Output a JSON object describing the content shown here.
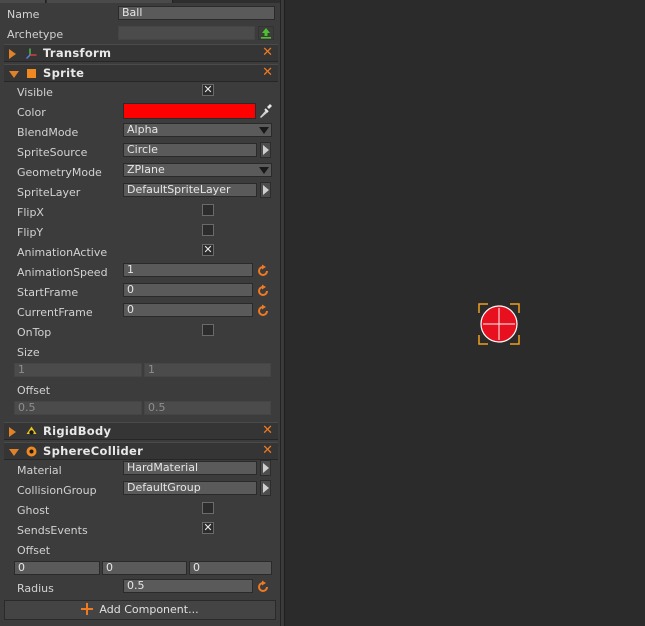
{
  "inspector": {
    "name_label": "Name",
    "name_value": "Ball",
    "archetype_label": "Archetype",
    "archetype_value": "",
    "components": {
      "transform": {
        "title": "Transform"
      },
      "sprite": {
        "title": "Sprite",
        "visible_label": "Visible",
        "visible_checked": true,
        "color_label": "Color",
        "color_value": "#ff0000",
        "blendmode_label": "BlendMode",
        "blendmode_value": "Alpha",
        "spritesource_label": "SpriteSource",
        "spritesource_value": "Circle",
        "geometrymode_label": "GeometryMode",
        "geometrymode_value": "ZPlane",
        "spritelayer_label": "SpriteLayer",
        "spritelayer_value": "DefaultSpriteLayer",
        "flipx_label": "FlipX",
        "flipx_checked": false,
        "flipy_label": "FlipY",
        "flipy_checked": false,
        "animationactive_label": "AnimationActive",
        "animationactive_checked": true,
        "animationspeed_label": "AnimationSpeed",
        "animationspeed_value": "1",
        "startframe_label": "StartFrame",
        "startframe_value": "0",
        "currentframe_label": "CurrentFrame",
        "currentframe_value": "0",
        "ontop_label": "OnTop",
        "ontop_checked": false,
        "size_label": "Size",
        "size_x": "1",
        "size_y": "1",
        "offset_label": "Offset",
        "offset_x": "0.5",
        "offset_y": "0.5"
      },
      "rigidbody": {
        "title": "RigidBody"
      },
      "spherecollider": {
        "title": "SphereCollider",
        "material_label": "Material",
        "material_value": "HardMaterial",
        "collisiongroup_label": "CollisionGroup",
        "collisiongroup_value": "DefaultGroup",
        "ghost_label": "Ghost",
        "ghost_checked": false,
        "sendsevents_label": "SendsEvents",
        "sendsevents_checked": true,
        "offset_label": "Offset",
        "offset_x": "0",
        "offset_y": "0",
        "offset_z": "0",
        "radius_label": "Radius",
        "radius_value": "0.5"
      }
    },
    "add_component_label": "Add Component...",
    "check_glyph": "✕",
    "remove_glyph": "✕"
  },
  "viewport": {
    "selected_object_color": "#e8101e",
    "selection_color": "#f0a020"
  }
}
